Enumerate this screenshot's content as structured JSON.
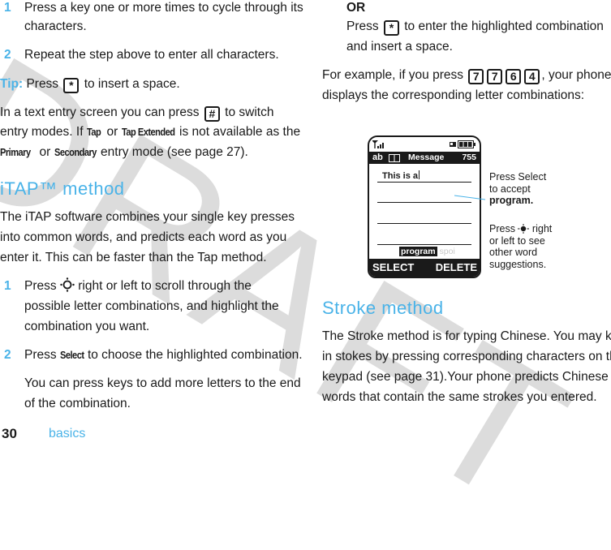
{
  "watermark": "DRAFT",
  "left_column": {
    "steps_top": [
      {
        "num": "1",
        "line1": "Press a key one or more times to cycle through its",
        "line2": "characters."
      },
      {
        "num": "2",
        "line1": "Repeat the step above to enter all characters."
      }
    ],
    "tip": {
      "label": "Tip:",
      "pre": "Press",
      "key": "*",
      "post": "to insert a space."
    },
    "mode_para": {
      "line1_pre": "In a text entry screen you can press",
      "line1_key": "#",
      "line1_post": "to switch",
      "line2_pre": "entry modes. If",
      "line2_b1": "Tap",
      "line2_mid": "or",
      "line2_b2": "Tap Extended",
      "line2_post": "is not available as the",
      "line3_b1": "Primary",
      "line3_mid": "or",
      "line3_b2": "Secondary",
      "line3_post": "entry mode (see page 27)."
    },
    "itap_heading": "iTAP™ method",
    "itap_para": [
      "The iTAP software combines your single key presses",
      "into common words, and predicts each word as you",
      "enter it. This can be faster than the Tap method."
    ],
    "itap_steps": [
      {
        "num": "1",
        "line1_pre": "Press",
        "line1_post": "right or left to scroll through the",
        "line2": "possible letter combinations, and highlight the",
        "line3": "combination you want."
      },
      {
        "num": "2",
        "pre": "Press",
        "bold": "Select",
        "post": "to choose the highlighted combination.",
        "sub1": "You can press keys to add more letters to the end",
        "sub2": "of the combination."
      }
    ]
  },
  "right_column": {
    "or_label": "OR",
    "or_line1_pre": "Press",
    "or_line1_key": "*",
    "or_line1_post": "to enter the highlighted combination",
    "or_line2": "and insert a space.",
    "example_pre": "For example, if you press",
    "example_keys": [
      "7",
      "7",
      "6",
      "4"
    ],
    "example_post": ", your phone",
    "example_line2": "displays the corresponding letter combinations:",
    "stroke_heading": "Stroke method",
    "stroke_para": [
      "The Stroke method is for typing Chinese. You may key",
      "in stokes by pressing corresponding characters on the",
      "keypad (see page 31).Your phone predicts Chinese",
      "words that contain the same strokes you entered."
    ]
  },
  "phone_screen": {
    "mode": "ab",
    "title": "Message",
    "counter": "755",
    "text": "This is a",
    "highlighted_word": "program",
    "alt_word": "spoi",
    "left_softkey": "SELECT",
    "right_softkey": "DELETE"
  },
  "callouts": {
    "select_line1": "Press Select",
    "select_line2": "to accept",
    "select_line3": "program.",
    "nav_pre": "Press",
    "nav_post": "right",
    "nav_line2": "or left to see",
    "nav_line3": "other word",
    "nav_line4": "suggestions."
  },
  "footer": {
    "page_number": "30",
    "section": "basics"
  },
  "colors": {
    "accent": "#4ab3e8",
    "text": "#1a1a1a",
    "watermark": "#dcdcdc"
  }
}
